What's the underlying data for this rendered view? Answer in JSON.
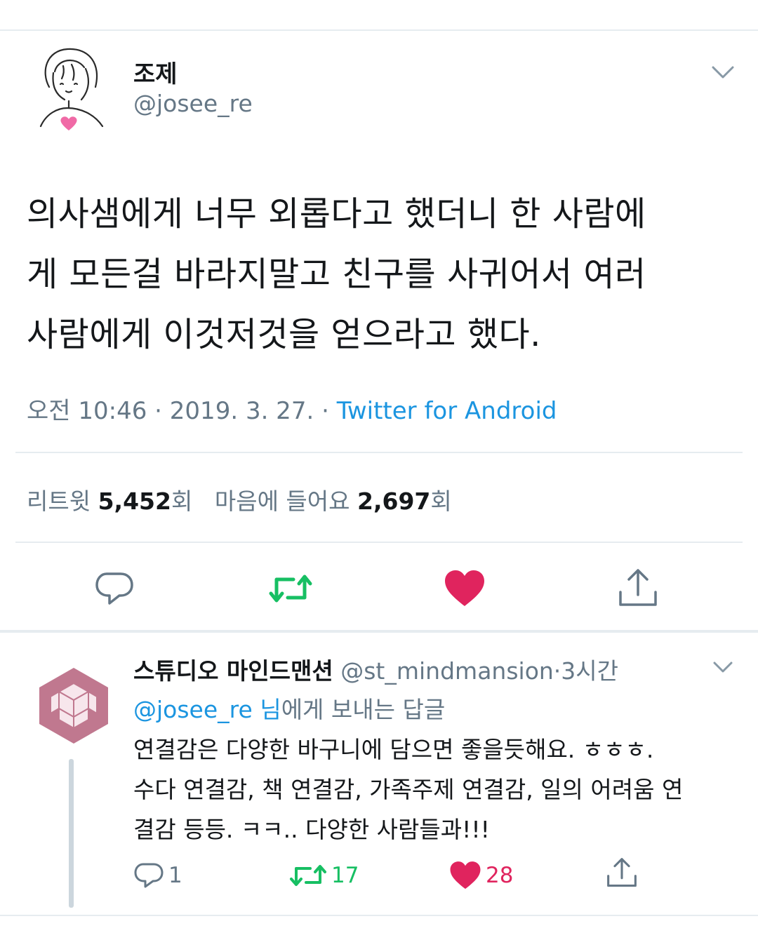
{
  "tweet": {
    "author": {
      "display_name": "조제",
      "handle": "@josee_re",
      "avatar_icon": "girl-with-heart-avatar-icon"
    },
    "body_lines": [
      "의사샘에게 너무 외롭다고 했더니 한 사람에",
      "게 모든걸 바라지말고 친구를 사귀어서 여러",
      "사람에게 이것저것을 얻으라고 했다."
    ],
    "meta": {
      "time": "오전 10:46",
      "date": "2019. 3. 27.",
      "separator": "·",
      "source": "Twitter for Android"
    },
    "stats": {
      "retweets_label": "리트윗",
      "retweets_count": "5,452",
      "retweets_unit": "회",
      "likes_label": "마음에 들어요",
      "likes_count": "2,697",
      "likes_unit": "회"
    },
    "actions": [
      "reply",
      "retweet",
      "like",
      "share"
    ]
  },
  "reply": {
    "author": {
      "display_name": "스튜디오 마인드맨션",
      "handle": "@st_mindmansion",
      "time": "3시간",
      "separator": "·"
    },
    "replying_to": {
      "mention": "@josee_re",
      "suffix_highlight": "님",
      "suffix": "에게 보내는 답글"
    },
    "body_lines": [
      "연결감은 다양한 바구니에 담으면 좋을듯해요. ㅎㅎㅎ.",
      "수다 연결감, 책 연결감, 가족주제 연결감, 일의 어려움 연",
      "결감 등등. ㅋㅋ.. 다양한 사람들과!!!"
    ],
    "counts": {
      "replies": "1",
      "retweets": "17",
      "likes": "28"
    }
  },
  "colors": {
    "text": "#14171a",
    "secondary": "#657786",
    "link": "#1b95e0",
    "like": "#e0245e",
    "retweet": "#17bf63",
    "avatar_bg": "#c0788f",
    "divider": "#e6ecf0"
  }
}
